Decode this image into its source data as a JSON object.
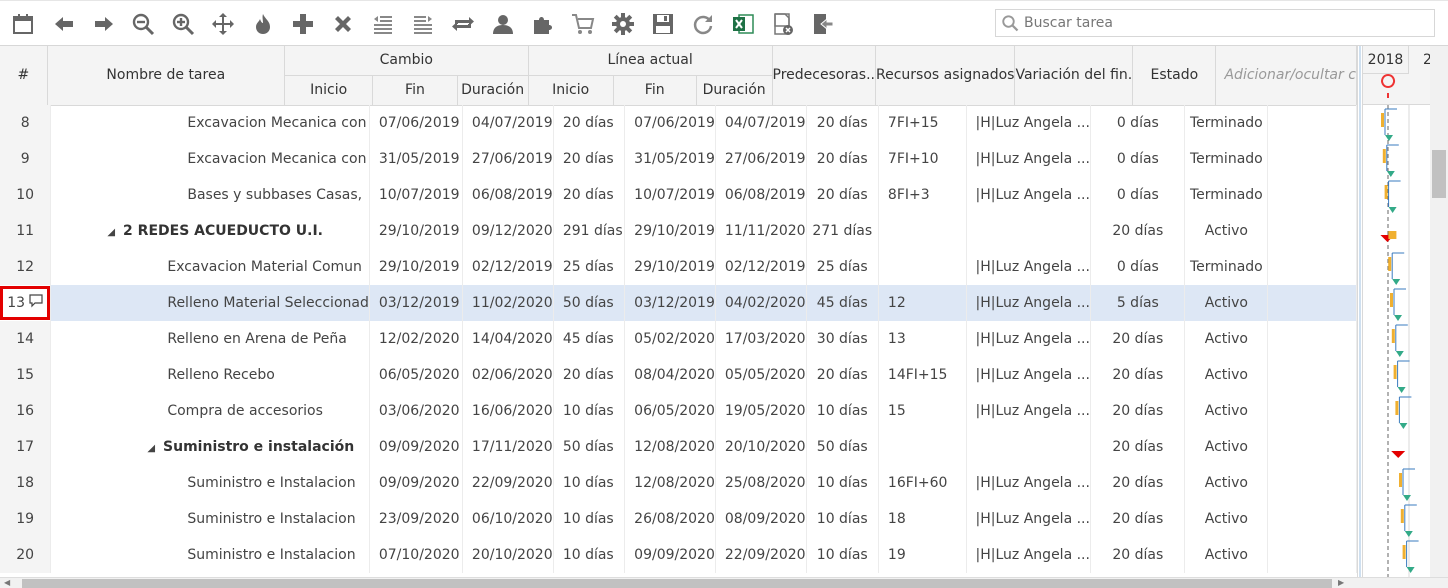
{
  "toolbar": {
    "icons": [
      "calendar-icon",
      "arrow-left-icon",
      "arrow-right-icon",
      "zoom-out-icon",
      "zoom-in-icon",
      "move-icon",
      "flame-icon",
      "plus-icon",
      "delete-icon",
      "outdent-icon",
      "indent-icon",
      "link-icon",
      "user-icon",
      "puzzle-icon",
      "cart-icon",
      "gear-icon",
      "save-icon",
      "refresh-icon",
      "excel-icon",
      "delete-doc-icon",
      "exit-icon"
    ],
    "search_placeholder": "Buscar tarea"
  },
  "header": {
    "num": "#",
    "name": "Nombre de tarea",
    "cambio": "Cambio",
    "linea": "Línea actual",
    "inicio": "Inicio",
    "fin": "Fin",
    "duracion": "Duración",
    "predecesoras": "Predecesoras..",
    "recursos": "Recursos asignados",
    "variacion": "Variación del fin.",
    "estado": "Estado",
    "add_hide": "Adicionar/ocultar c"
  },
  "gantt": {
    "year": "2018",
    "next_year": "2"
  },
  "rows": [
    {
      "num": "8",
      "name": "Excavacion Mecanica con",
      "level": 2,
      "group": false,
      "c_ini": "07/06/2019",
      "c_fin": "04/07/2019",
      "c_dur": "20 días",
      "l_ini": "07/06/2019",
      "l_fin": "04/07/2019",
      "l_dur": "20 días",
      "pred": "7FI+15",
      "rec": "|H|Luz Angela ...",
      "var": "0 días",
      "estado": "Terminado"
    },
    {
      "num": "9",
      "name": "Excavacion Mecanica con",
      "level": 2,
      "group": false,
      "c_ini": "31/05/2019",
      "c_fin": "27/06/2019",
      "c_dur": "20 días",
      "l_ini": "31/05/2019",
      "l_fin": "27/06/2019",
      "l_dur": "20 días",
      "pred": "7FI+10",
      "rec": "|H|Luz Angela ...",
      "var": "0 días",
      "estado": "Terminado"
    },
    {
      "num": "10",
      "name": "Bases y subbases Casas,",
      "level": 2,
      "group": false,
      "c_ini": "10/07/2019",
      "c_fin": "06/08/2019",
      "c_dur": "20 días",
      "l_ini": "10/07/2019",
      "l_fin": "06/08/2019",
      "l_dur": "20 días",
      "pred": "8FI+3",
      "rec": "|H|Luz Angela ...",
      "var": "0 días",
      "estado": "Terminado"
    },
    {
      "num": "11",
      "name": "2 REDES ACUEDUCTO U.I.",
      "level": 0,
      "group": true,
      "c_ini": "29/10/2019",
      "c_fin": "09/12/2020",
      "c_dur": "291 días",
      "l_ini": "29/10/2019",
      "l_fin": "11/11/2020",
      "l_dur": "271 días",
      "pred": "",
      "rec": "",
      "var": "20 días",
      "estado": "Activo"
    },
    {
      "num": "12",
      "name": "Excavacion Material Comun",
      "level": 1,
      "group": false,
      "c_ini": "29/10/2019",
      "c_fin": "02/12/2019",
      "c_dur": "25 días",
      "l_ini": "29/10/2019",
      "l_fin": "02/12/2019",
      "l_dur": "25 días",
      "pred": "",
      "rec": "|H|Luz Angela ...",
      "var": "0 días",
      "estado": "Terminado"
    },
    {
      "num": "13",
      "name": "Relleno Material Seleccionad",
      "level": 1,
      "group": false,
      "selected": true,
      "c_ini": "03/12/2019",
      "c_fin": "11/02/2020",
      "c_dur": "50 días",
      "l_ini": "03/12/2019",
      "l_fin": "04/02/2020",
      "l_dur": "45 días",
      "pred": "12",
      "rec": "|H|Luz Angela ...",
      "var": "5 días",
      "estado": "Activo"
    },
    {
      "num": "14",
      "name": "Relleno en Arena de Peña",
      "level": 1,
      "group": false,
      "c_ini": "12/02/2020",
      "c_fin": "14/04/2020",
      "c_dur": "45 días",
      "l_ini": "05/02/2020",
      "l_fin": "17/03/2020",
      "l_dur": "30 días",
      "pred": "13",
      "rec": "|H|Luz Angela ...",
      "var": "20 días",
      "estado": "Activo"
    },
    {
      "num": "15",
      "name": "Relleno Recebo",
      "level": 1,
      "group": false,
      "c_ini": "06/05/2020",
      "c_fin": "02/06/2020",
      "c_dur": "20 días",
      "l_ini": "08/04/2020",
      "l_fin": "05/05/2020",
      "l_dur": "20 días",
      "pred": "14FI+15",
      "rec": "|H|Luz Angela ...",
      "var": "20 días",
      "estado": "Activo"
    },
    {
      "num": "16",
      "name": "Compra de accesorios",
      "level": 1,
      "group": false,
      "c_ini": "03/06/2020",
      "c_fin": "16/06/2020",
      "c_dur": "10 días",
      "l_ini": "06/05/2020",
      "l_fin": "19/05/2020",
      "l_dur": "10 días",
      "pred": "15",
      "rec": "|H|Luz Angela ...",
      "var": "20 días",
      "estado": "Activo"
    },
    {
      "num": "17",
      "name": "Suministro e instalación",
      "level": 1,
      "group": true,
      "c_ini": "09/09/2020",
      "c_fin": "17/11/2020",
      "c_dur": "50 días",
      "l_ini": "12/08/2020",
      "l_fin": "20/10/2020",
      "l_dur": "50 días",
      "pred": "",
      "rec": "",
      "var": "20 días",
      "estado": "Activo"
    },
    {
      "num": "18",
      "name": "Suministro e Instalacion",
      "level": 2,
      "group": false,
      "c_ini": "09/09/2020",
      "c_fin": "22/09/2020",
      "c_dur": "10 días",
      "l_ini": "12/08/2020",
      "l_fin": "25/08/2020",
      "l_dur": "10 días",
      "pred": "16FI+60",
      "rec": "|H|Luz Angela ...",
      "var": "20 días",
      "estado": "Activo"
    },
    {
      "num": "19",
      "name": "Suministro e Instalacion",
      "level": 2,
      "group": false,
      "c_ini": "23/09/2020",
      "c_fin": "06/10/2020",
      "c_dur": "10 días",
      "l_ini": "26/08/2020",
      "l_fin": "08/09/2020",
      "l_dur": "10 días",
      "pred": "18",
      "rec": "|H|Luz Angela ...",
      "var": "20 días",
      "estado": "Activo"
    },
    {
      "num": "20",
      "name": "Suministro e Instalacion",
      "level": 2,
      "group": false,
      "c_ini": "07/10/2020",
      "c_fin": "20/10/2020",
      "c_dur": "10 días",
      "l_ini": "09/09/2020",
      "l_fin": "22/09/2020",
      "l_dur": "10 días",
      "pred": "19",
      "rec": "|H|Luz Angela ...",
      "var": "20 días",
      "estado": "Activo"
    }
  ],
  "colors": {
    "selected_row": "#dde7f5",
    "highlight_border": "#e30000",
    "bar_baseline": "#f0b030",
    "milestone": "#33aa88",
    "critical": "#e30000"
  }
}
